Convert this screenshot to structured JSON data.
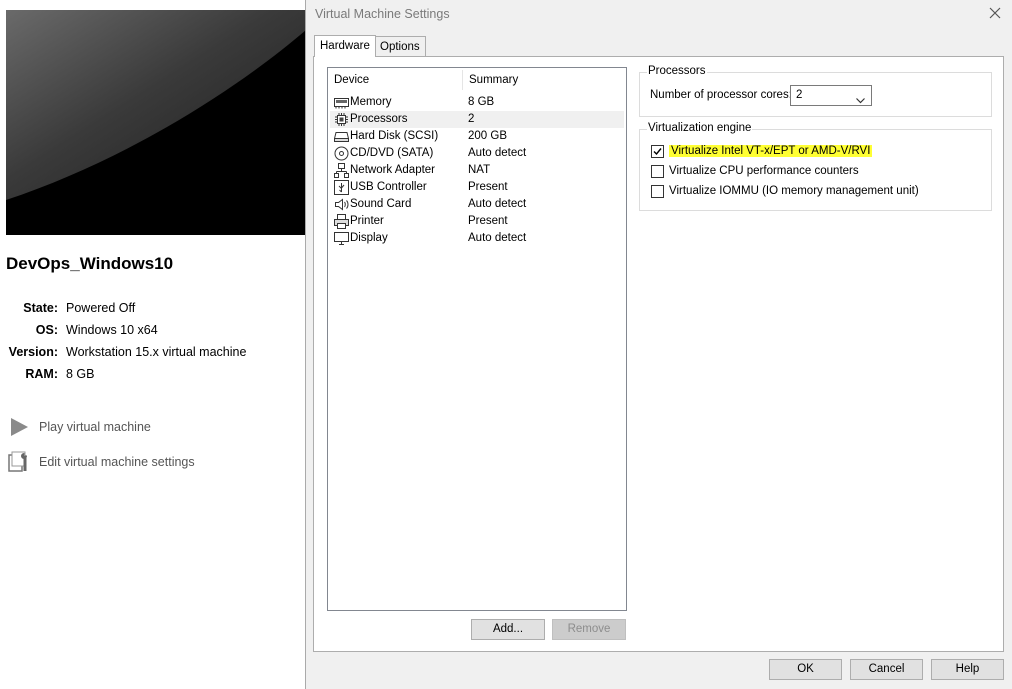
{
  "vm": {
    "name": "DevOps_Windows10",
    "details": [
      {
        "label": "State:",
        "value": "Powered Off"
      },
      {
        "label": "OS:",
        "value": "Windows 10 x64"
      },
      {
        "label": "Version:",
        "value": "Workstation 15.x virtual machine"
      },
      {
        "label": "RAM:",
        "value": "8 GB"
      }
    ],
    "actions": {
      "play": "Play virtual machine",
      "edit": "Edit virtual machine settings"
    }
  },
  "dialog": {
    "title": "Virtual Machine Settings",
    "tabs": [
      "Hardware",
      "Options"
    ],
    "device_list": {
      "headers": [
        "Device",
        "Summary"
      ],
      "rows": [
        {
          "device": "Memory",
          "summary": "8 GB",
          "icon": "memory-icon"
        },
        {
          "device": "Processors",
          "summary": "2",
          "icon": "processor-icon"
        },
        {
          "device": "Hard Disk (SCSI)",
          "summary": "200 GB",
          "icon": "hard-disk-icon"
        },
        {
          "device": "CD/DVD (SATA)",
          "summary": "Auto detect",
          "icon": "cd-dvd-icon"
        },
        {
          "device": "Network Adapter",
          "summary": "NAT",
          "icon": "network-adapter-icon"
        },
        {
          "device": "USB Controller",
          "summary": "Present",
          "icon": "usb-icon"
        },
        {
          "device": "Sound Card",
          "summary": "Auto detect",
          "icon": "speaker-icon"
        },
        {
          "device": "Printer",
          "summary": "Present",
          "icon": "printer-icon"
        },
        {
          "device": "Display",
          "summary": "Auto detect",
          "icon": "display-icon"
        }
      ],
      "selected": "Processors"
    },
    "list_buttons": {
      "add": "Add...",
      "remove": "Remove"
    },
    "processors": {
      "title": "Processors",
      "cores_label": "Number of processor cores:",
      "cores_value": "2"
    },
    "virtualization": {
      "title": "Virtualization engine",
      "options": [
        {
          "label": "Virtualize Intel VT-x/EPT or AMD-V/RVI",
          "checked": true,
          "highlighted": true
        },
        {
          "label": "Virtualize CPU performance counters",
          "checked": false
        },
        {
          "label": "Virtualize IOMMU (IO memory management unit)",
          "checked": false
        }
      ]
    },
    "footer": {
      "ok": "OK",
      "cancel": "Cancel",
      "help": "Help"
    }
  },
  "colors": {
    "highlight": "#ffff33",
    "selected_row": "#f0f0f0"
  }
}
